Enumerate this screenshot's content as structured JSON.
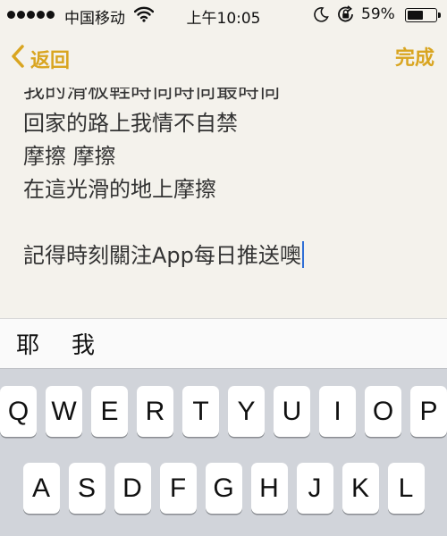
{
  "status_bar": {
    "carrier": "中国移动",
    "time": "上午10:05",
    "battery_percent": "59%",
    "battery_level": 0.59,
    "icons": [
      "signal-dots-icon",
      "wifi-icon",
      "moon-icon",
      "rotation-lock-icon",
      "battery-icon"
    ]
  },
  "nav": {
    "back_label": "返回",
    "done_label": "完成",
    "accent_color": "#d9a520"
  },
  "note": {
    "lines": [
      "我的滑板鞋時尚時尚最時尚",
      "回家的路上我情不自禁",
      "摩擦 摩擦",
      "在這光滑的地上摩擦",
      "",
      "記得時刻關注App每日推送噢"
    ],
    "caret_color": "#2f6fd6"
  },
  "candidates": [
    "耶",
    "我"
  ],
  "keyboard": {
    "row1": [
      "Q",
      "W",
      "E",
      "R",
      "T",
      "Y",
      "U",
      "I",
      "O",
      "P"
    ],
    "row2": [
      "A",
      "S",
      "D",
      "F",
      "G",
      "H",
      "J",
      "K",
      "L"
    ]
  }
}
